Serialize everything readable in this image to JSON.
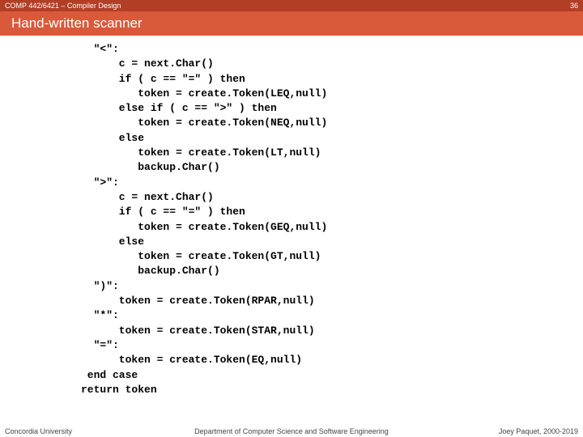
{
  "header": {
    "course": "COMP 442/6421 – Compiler Design",
    "page_number": "36",
    "title": "Hand-written scanner"
  },
  "code": "  \"<\":\n      c = next.Char()\n      if ( c == \"=\" ) then\n         token = create.Token(LEQ,null)\n      else if ( c == \">\" ) then\n         token = create.Token(NEQ,null)\n      else\n         token = create.Token(LT,null)\n         backup.Char()\n  \">\":\n      c = next.Char()\n      if ( c == \"=\" ) then\n         token = create.Token(GEQ,null)\n      else\n         token = create.Token(GT,null)\n         backup.Char()\n  \")\":\n      token = create.Token(RPAR,null)\n  \"*\":\n      token = create.Token(STAR,null)\n  \"=\":\n      token = create.Token(EQ,null)\n end case\nreturn token",
  "footer": {
    "left": "Concordia University",
    "center": "Department of Computer Science and Software Engineering",
    "right": "Joey Paquet, 2000-2019"
  }
}
